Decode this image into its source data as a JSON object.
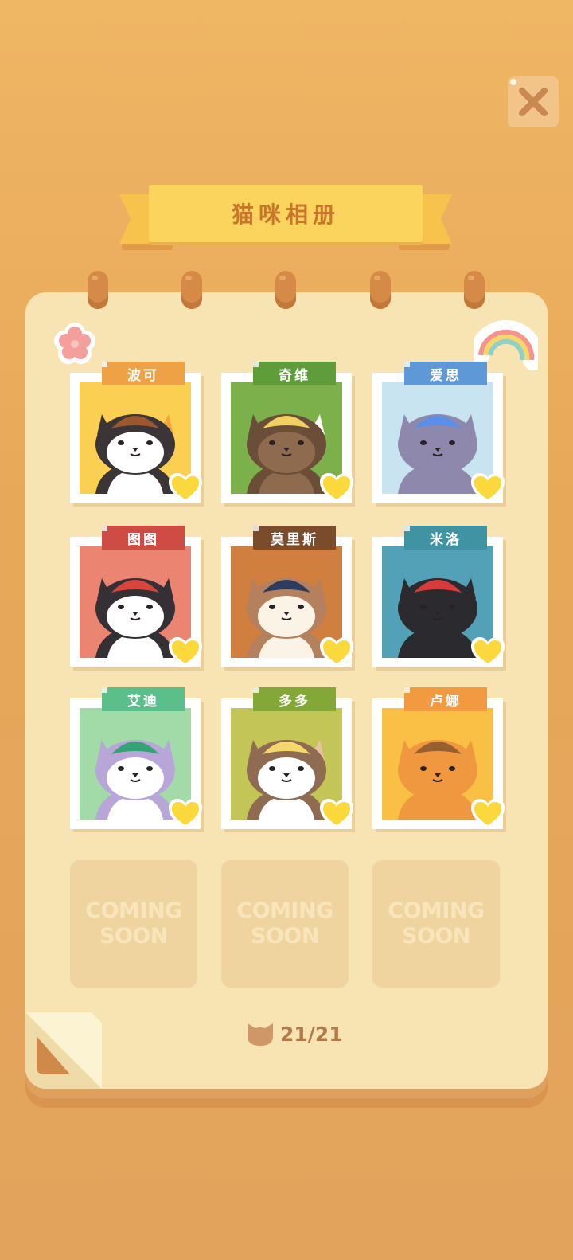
{
  "header": {
    "title": "猫咪相册"
  },
  "cats": [
    {
      "name": "波可",
      "tag_color": "#efa145",
      "bg": "#fbd052",
      "fur": "#ffffff",
      "patch": "#3b3537",
      "patch2": "#f4a23a",
      "hat": "#9b5830"
    },
    {
      "name": "奇维",
      "tag_color": "#5f9c3a",
      "bg": "#7bb04a",
      "fur": "#8e6b4e",
      "patch": "#6b4e38",
      "patch2": "#fbfbf6",
      "hat": "#f2d061"
    },
    {
      "name": "爱思",
      "tag_color": "#5f98d7",
      "bg": "#c8e4f1",
      "fur": "#8f88ad",
      "patch": "#8f88ad",
      "patch2": "#8f88ad",
      "hat": "#5b8ee6"
    },
    {
      "name": "图图",
      "tag_color": "#cf4c45",
      "bg": "#eb8572",
      "fur": "#ffffff",
      "patch": "#343035",
      "patch2": "#343035",
      "hat": "#d8453c"
    },
    {
      "name": "莫里斯",
      "tag_color": "#7b4c2c",
      "bg": "#d07f3e",
      "fur": "#fbf3e6",
      "patch": "#b5805d",
      "patch2": "#b5805d",
      "hat": "#2c3c5c"
    },
    {
      "name": "米洛",
      "tag_color": "#3f93a3",
      "bg": "#53a1b6",
      "fur": "#2b2b2f",
      "patch": "#2b2b2f",
      "patch2": "#2b2b2f",
      "hat": "#d63c3c"
    },
    {
      "name": "艾迪",
      "tag_color": "#5bbf8b",
      "bg": "#a3dba8",
      "fur": "#ffffff",
      "patch": "#b8a6d9",
      "patch2": "#b8a6d9",
      "hat": "#34a375"
    },
    {
      "name": "多多",
      "tag_color": "#84a837",
      "bg": "#c3c556",
      "fur": "#ffffff",
      "patch": "#8f6b51",
      "patch2": "#e7c49f",
      "hat": "#f4d86c"
    },
    {
      "name": "卢娜",
      "tag_color": "#f29a40",
      "bg": "#f9c045",
      "fur": "#f0983f",
      "patch": "#f0983f",
      "patch2": "#f0983f",
      "hat": "#98602f"
    }
  ],
  "coming_soon": [
    {
      "line1": "COMING",
      "line2": "SOON"
    },
    {
      "line1": "COMING",
      "line2": "SOON"
    },
    {
      "line1": "COMING",
      "line2": "SOON"
    }
  ],
  "footer": {
    "counter": "21/21"
  },
  "colors": {
    "heart": "#fbd93c",
    "album": "#f8e3b2",
    "accent": "#c9752a"
  },
  "icons": {
    "close": "close-icon",
    "flower": "flower-sticker",
    "rainbow": "rainbow-sticker",
    "cat": "cat-head-icon",
    "heart": "heart-icon"
  }
}
